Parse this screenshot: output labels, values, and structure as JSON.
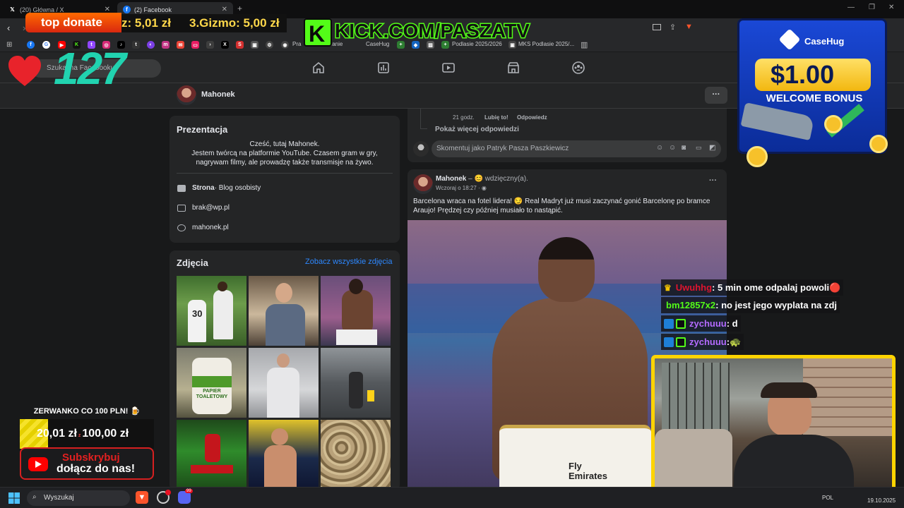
{
  "browser": {
    "tabs": [
      {
        "label": "(20) Główna / X",
        "icon": "x-logo-icon"
      },
      {
        "label": "(2) Facebook",
        "icon": "facebook-logo-icon"
      }
    ],
    "new_tab": "+",
    "url_visible": "KICK.COM/PASZATV",
    "bookmarks": [
      "Pra",
      "owanie",
      "CaseHug",
      "Podlasie 2025/2026",
      "MKS Podlasie 2025/..."
    ]
  },
  "facebook": {
    "search_placeholder": "Szukaj na Facebooku",
    "profile_name": "Mahonek",
    "more_button": "···",
    "intro": {
      "title": "Prezentacja",
      "bio": "Cześć, tutaj Mahonek.\nJestem twórcą na platformie YouTube. Czasem gram w gry, nagrywam filmy, ale prowadzę także transmisje na żywo.",
      "page_label": "Strona",
      "page_category": " · Blog osobisty",
      "email": "brak@wp.pl",
      "website": "mahonek.pl"
    },
    "photos": {
      "title": "Zdjęcia",
      "see_all": "Zobacz wszystkie zdjęcia",
      "thumb_texts": [
        "30",
        "PAPIER TOALETOWY"
      ]
    },
    "comment_tail": {
      "time": "21 godz.",
      "like": "Lubię to!",
      "reply": "Odpowiedz",
      "more_replies": "Pokaż więcej odpowiedzi",
      "comment_placeholder": "Skomentuj jako Patryk Pasza Paszkiewicz"
    },
    "post": {
      "author": "Mahonek",
      "feeling": " – 😊 wdzięczny(a).",
      "time": "Wczoraj o 18:27 · ",
      "text": "Barcelona wraca na fotel lidera! 😏 Real Madryt już musi zaczynać gonić Barcelonę po bramce Araujo!  Prędzej czy później musiało to nastąpić.",
      "shirt_text": "Fly Emirates"
    }
  },
  "overlay": {
    "donate_label": "top donate",
    "donors": [
      {
        "text": "z: 5,01 zł"
      },
      {
        "text": "3.Gizmo: 5,00 zł"
      }
    ],
    "likes_count": "127",
    "kick_url": "KICK.COM/PASZATV",
    "casehug": {
      "brand": "CaseHug",
      "amount": "$1.00",
      "bonus": "WELCOME BONUS"
    },
    "goal": {
      "title": "ZERWANKO CO 100 PLN! 🍺",
      "current": "20,01 zł",
      "sep": " z ",
      "target": "100,00 zł"
    },
    "subscribe": {
      "line1": "Subskrybuj",
      "line2": "dołącz do nas!"
    },
    "chat": [
      {
        "user": "Uwuhhg",
        "msg": ": 5 min ome odpalaj powoli ",
        "user_color": "#e0142e",
        "emoji": "🔴"
      },
      {
        "user": "bm12857x2",
        "msg": " : no jest jego wyplata na zdj",
        "user_color": "#53fc18",
        "emoji": ""
      },
      {
        "user": "zychuuu",
        "msg": " : d",
        "user_color": "#b46bff",
        "emoji": ""
      },
      {
        "user": "zychuuu",
        "msg": " : ",
        "user_color": "#b46bff",
        "emoji": "🐢"
      }
    ]
  },
  "taskbar": {
    "search_placeholder": "Wyszukaj",
    "lang": "POL",
    "date": "19.10.2025",
    "notification_count": "99"
  },
  "colors": {
    "kick_green": "#53fc18",
    "fb_blue": "#2d88ff",
    "likes_teal": "#21d3b0",
    "cam_border": "#ffd400"
  }
}
